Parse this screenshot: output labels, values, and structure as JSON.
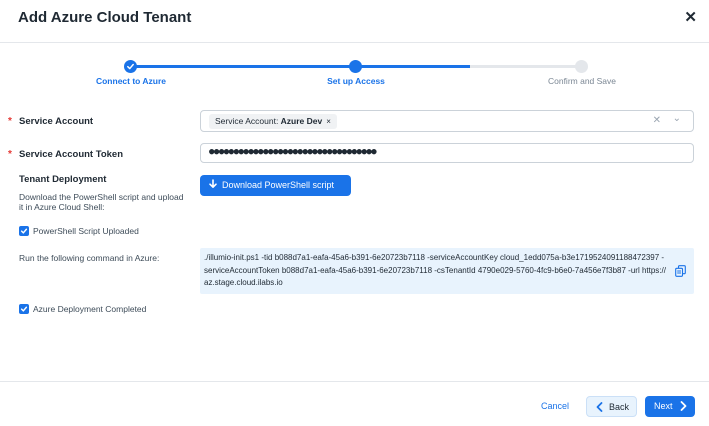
{
  "dialog": {
    "title": "Add Azure Cloud Tenant",
    "close_glyph": "✕"
  },
  "stepper": {
    "steps": [
      {
        "label": "Connect to Azure",
        "state": "completed"
      },
      {
        "label": "Set up Access",
        "state": "current"
      },
      {
        "label": "Confirm and Save",
        "state": "pending"
      }
    ]
  },
  "form": {
    "required_marker": "*",
    "service_account": {
      "label": "Service Account",
      "chip_prefix": "Service Account: ",
      "chip_value": "Azure Dev",
      "chip_remove": "×",
      "clear_glyph": "✕",
      "chevron_glyph": "⌄"
    },
    "token": {
      "label": "Service Account Token",
      "value": "●●●●●●●●●●●●●●●●●●●●●●●●●●●●●●●●●●"
    },
    "tenant_deployment": {
      "label": "Tenant Deployment",
      "help": "Download the PowerShell script and upload it in Azure Cloud Shell:",
      "download_button": "Download PowerShell script",
      "script_uploaded": {
        "label": "PowerShell Script Uploaded",
        "checked": true
      }
    },
    "command": {
      "label": "Run the following command in Azure:",
      "text": "./illumio-init.ps1 -tid b088d7a1-eafa-45a6-b391-6e20723b7118 -serviceAccountKey cloud_1edd075a-b3e1719524091188472397 -serviceAccountToken  b088d7a1-eafa-45a6-b391-6e20723b7118 -csTenantId 4790e029-5760-4fc9-b6e0-7a456e7f3b87 -url https://az.stage.cloud.ilabs.io"
    },
    "deployment_completed": {
      "label": "Azure Deployment Completed",
      "checked": true
    }
  },
  "footer": {
    "cancel": "Cancel",
    "back": "Back",
    "next": "Next"
  },
  "colors": {
    "primary": "#1a73e8",
    "required": "#e53935",
    "command_bg": "#e8f3fd",
    "step_pending": "#e4e7eb"
  },
  "icons": [
    "close-icon",
    "check-icon",
    "download-icon",
    "copy-icon",
    "chevron-down-icon",
    "chevron-left-icon",
    "chevron-right-icon"
  ]
}
